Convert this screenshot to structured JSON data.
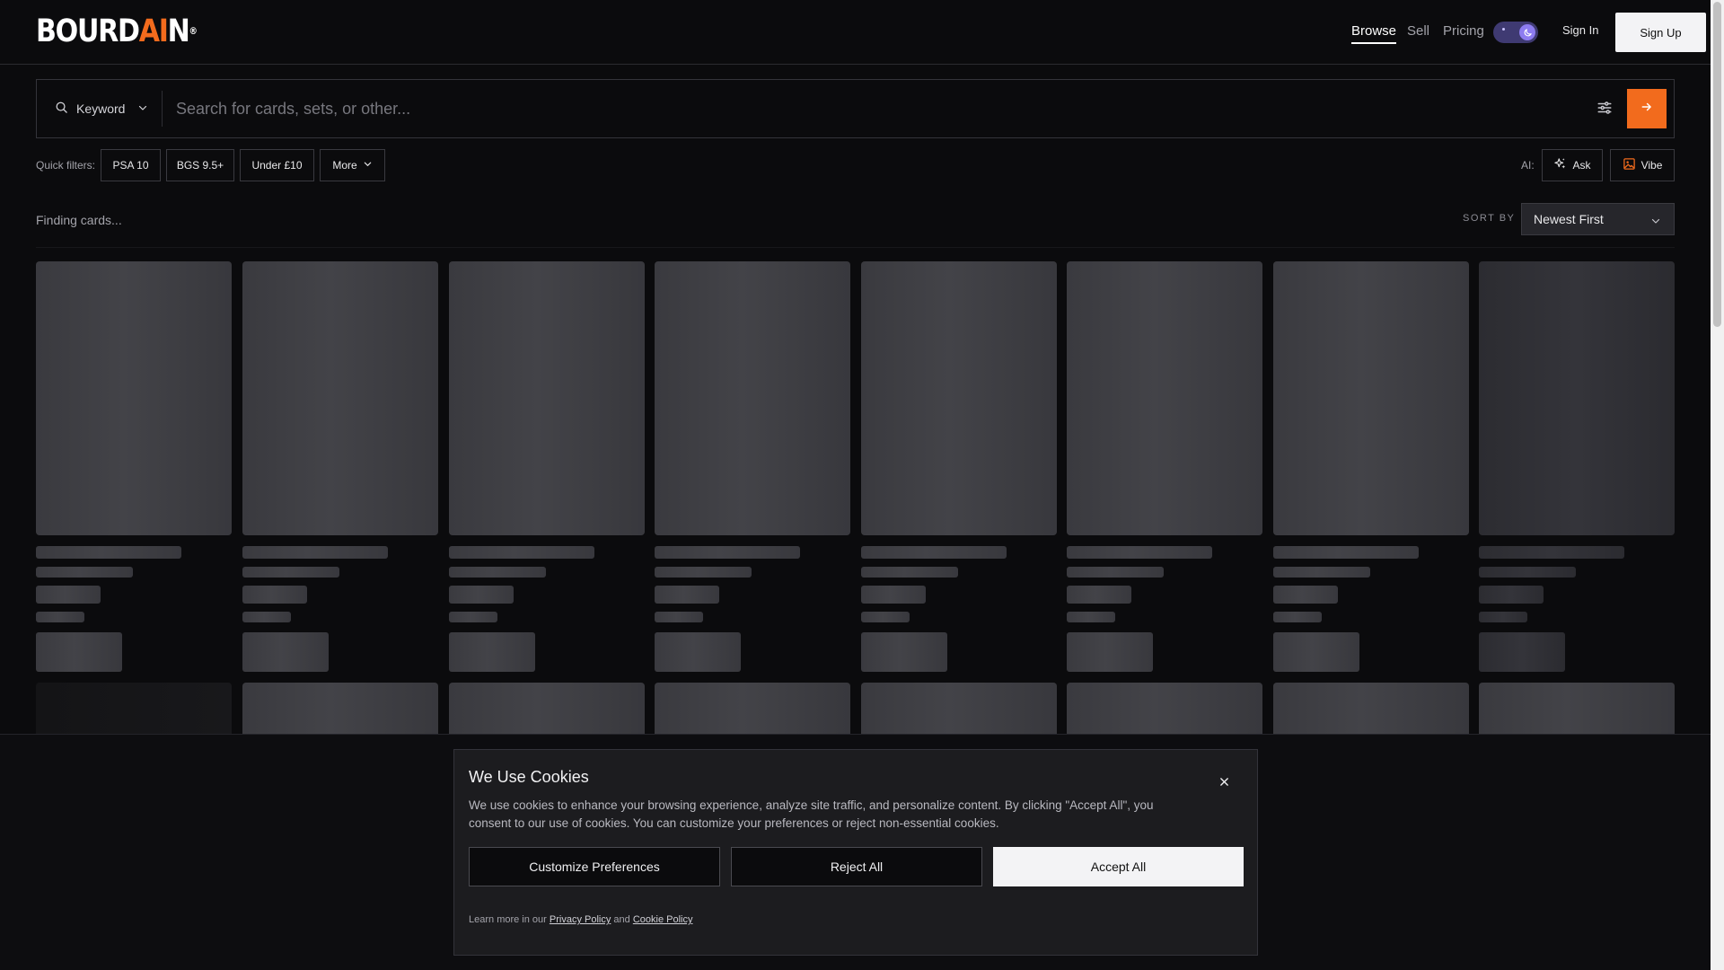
{
  "header": {
    "logo_main": "BOURD",
    "logo_accent": "AI",
    "logo_end": "N",
    "logo_mark": "®",
    "nav": [
      {
        "label": "Browse",
        "active": true
      },
      {
        "label": "Sell",
        "active": false
      },
      {
        "label": "Pricing",
        "active": false
      }
    ],
    "theme_icon": "moon-icon",
    "sign_in": "Sign In",
    "sign_up": "Sign Up"
  },
  "search": {
    "type_label": "Keyword",
    "placeholder": "Search for cards, sets, or other...",
    "value": "",
    "type_icon": "search-icon",
    "filter_icon": "sliders-icon",
    "submit_icon": "arrow-right-icon"
  },
  "quick_filters": {
    "label": "Quick filters:",
    "chips": [
      "PSA 10",
      "BGS 9.5+",
      "Under £10",
      "More"
    ],
    "ai_label": "AI:",
    "ai_buttons": [
      {
        "label": "Ask",
        "icon": "sparkles-icon"
      },
      {
        "label": "Vibe",
        "icon": "image-icon"
      }
    ]
  },
  "results": {
    "status": "Finding cards...",
    "sort_label": "SORT BY",
    "sort_value": "Newest First"
  },
  "cookie": {
    "title": "We Use Cookies",
    "text": "We use cookies to enhance your browsing experience, analyze site traffic, and personalize content. By clicking \"Accept All\", you consent to our use of cookies. You can customize your preferences or reject non-essential cookies.",
    "buttons": {
      "customize": "Customize Preferences",
      "reject": "Reject All",
      "accept": "Accept All"
    },
    "footer_prefix": "Learn more in our",
    "privacy_link": "Privacy Policy",
    "footer_and": "and",
    "cookie_link": "Cookie Policy"
  },
  "colors": {
    "accent": "#f26b1d",
    "background": "#0b0b0d",
    "toggle": "#8d7cf0"
  }
}
